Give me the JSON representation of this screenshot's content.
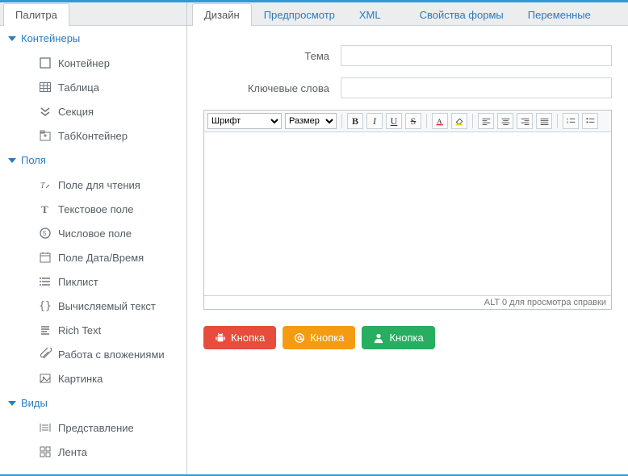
{
  "sidebar": {
    "tab": "Палитра",
    "groups": [
      {
        "title": "Контейнеры",
        "items": [
          {
            "label": "Контейнер",
            "icon": "square-icon"
          },
          {
            "label": "Таблица",
            "icon": "table-icon"
          },
          {
            "label": "Секция",
            "icon": "chevrons-down-icon"
          },
          {
            "label": "ТабКонтейнер",
            "icon": "tab-container-icon"
          }
        ]
      },
      {
        "title": "Поля",
        "items": [
          {
            "label": "Поле для чтения",
            "icon": "readonly-icon"
          },
          {
            "label": "Текстовое поле",
            "icon": "text-t-icon"
          },
          {
            "label": "Числовое поле",
            "icon": "number-icon"
          },
          {
            "label": "Поле Дата/Время",
            "icon": "calendar-icon"
          },
          {
            "label": "Пиклист",
            "icon": "list-icon"
          },
          {
            "label": "Вычисляемый текст",
            "icon": "braces-icon"
          },
          {
            "label": "Rich Text",
            "icon": "richtext-icon"
          },
          {
            "label": "Работа с вложениями",
            "icon": "attachment-icon"
          },
          {
            "label": "Картинка",
            "icon": "image-icon"
          }
        ]
      },
      {
        "title": "Виды",
        "items": [
          {
            "label": "Представление",
            "icon": "view-icon"
          },
          {
            "label": "Лента",
            "icon": "feed-icon"
          }
        ]
      }
    ]
  },
  "main": {
    "tabs": [
      {
        "label": "Дизайн",
        "active": true
      },
      {
        "label": "Предпросмотр",
        "active": false
      },
      {
        "label": "XML",
        "active": false
      },
      {
        "label": "Свойства формы",
        "active": false
      },
      {
        "label": "Переменные",
        "active": false
      }
    ],
    "form": {
      "subject_label": "Тема",
      "subject_value": "",
      "keywords_label": "Ключевые слова",
      "keywords_value": ""
    },
    "rte": {
      "font_label": "Шрифт",
      "size_label": "Размер",
      "status": "ALT 0 для просмотра справки",
      "tools": {
        "bold": "B",
        "italic": "I",
        "underline": "U",
        "strike": "S"
      }
    },
    "buttons": [
      {
        "label": "Кнопка",
        "color": "red",
        "icon": "android-icon"
      },
      {
        "label": "Кнопка",
        "color": "orange",
        "icon": "at-icon"
      },
      {
        "label": "Кнопка",
        "color": "green",
        "icon": "user-icon"
      }
    ]
  }
}
